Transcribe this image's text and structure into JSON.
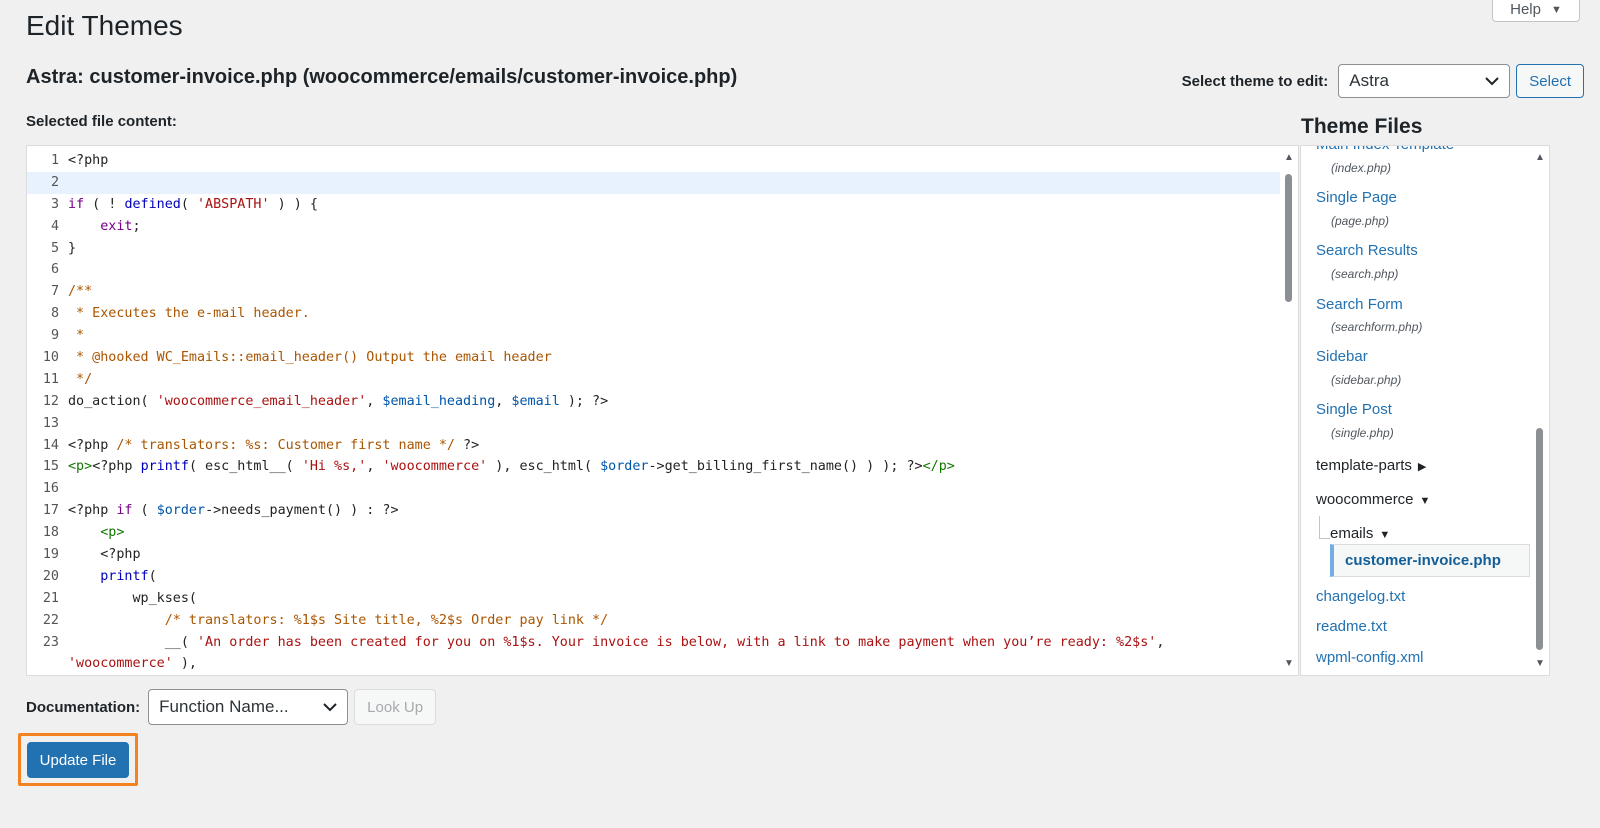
{
  "help": {
    "label": "Help",
    "caret": "▼"
  },
  "page": {
    "title": "Edit Themes",
    "file_title": "Astra: customer-invoice.php (woocommerce/emails/customer-invoice.php)"
  },
  "theme_selector": {
    "label": "Select theme to edit:",
    "value": "Astra",
    "button": "Select"
  },
  "editor": {
    "label": "Selected file content:"
  },
  "theme_files": {
    "title": "Theme Files",
    "items": [
      {
        "label": "Main Index Template",
        "file": "(index.php)"
      },
      {
        "label": "Single Page",
        "file": "(page.php)"
      },
      {
        "label": "Search Results",
        "file": "(search.php)"
      },
      {
        "label": "Search Form",
        "file": "(searchform.php)"
      },
      {
        "label": "Sidebar",
        "file": "(sidebar.php)"
      },
      {
        "label": "Single Post",
        "file": "(single.php)"
      }
    ],
    "folders": [
      "template-parts",
      "woocommerce",
      "emails"
    ],
    "current": "customer-invoice.php",
    "bottom_files": [
      "changelog.txt",
      "readme.txt",
      "wpml-config.xml"
    ]
  },
  "documentation": {
    "label": "Documentation:",
    "select_value": "Function Name...",
    "button": "Look Up"
  },
  "update_button": "Update File",
  "colors": {
    "primary": "#2271b1",
    "highlight": "#f58220"
  }
}
